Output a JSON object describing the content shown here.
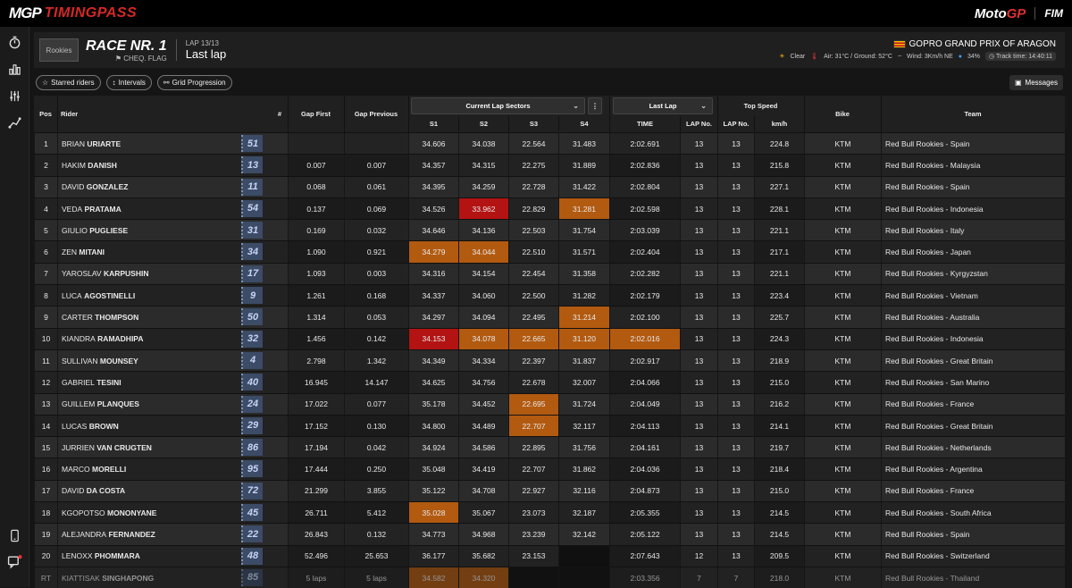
{
  "app": {
    "brand_mgp": "MGP",
    "brand_tp": "TIMINGPASS",
    "logo_moto": "Moto",
    "logo_gp": "GP",
    "logo_fim": "FIM"
  },
  "sidebar": [
    "stopwatch-icon",
    "bar-chart-icon",
    "gauge-icon",
    "track-icon",
    "phone-icon",
    "chat-alert-icon"
  ],
  "header": {
    "logo_text": "Rookies",
    "race_title": "RACE NR. 1",
    "race_status": "CHEQ. FLAG",
    "lap_label": "LAP 13/13",
    "lap_view": "Last lap",
    "gp_name": "GOPRO GRAND PRIX OF ARAGON",
    "weather": {
      "sky": "Clear",
      "temps": "Air: 31°C / Ground: 52°C",
      "wind": "Wind: 3Km/h NE",
      "humidity": "34%",
      "track_time": "Track time: 14:40:11"
    }
  },
  "controls": {
    "starred": "Starred riders",
    "intervals": "Intervals",
    "grid": "Grid Progression",
    "messages": "Messages"
  },
  "columns": {
    "pos": "Pos",
    "rider": "Rider",
    "num": "#",
    "gap_first": "Gap First",
    "gap_prev": "Gap Previous",
    "sectors_dropdown": "Current Lap Sectors",
    "s1": "S1",
    "s2": "S2",
    "s3": "S3",
    "s4": "S4",
    "lap_dropdown": "Last Lap",
    "time": "TIME",
    "lapno1": "LAP No.",
    "top_speed": "Top Speed",
    "lapno2": "LAP No.",
    "kmh": "km/h",
    "bike": "Bike",
    "team": "Team"
  },
  "rows": [
    {
      "pos": "1",
      "first": "BRIAN",
      "last": "URIARTE",
      "num": "51",
      "gf": "",
      "gp": "",
      "s1": "34.606",
      "s2": "34.038",
      "s3": "22.564",
      "s4": "31.483",
      "time": "2:02.691",
      "lap1": "13",
      "lap2": "13",
      "kmh": "224.8",
      "bike": "KTM",
      "team": "Red Bull Rookies - Spain",
      "hl": {}
    },
    {
      "pos": "2",
      "first": "HAKIM",
      "last": "DANISH",
      "num": "13",
      "gf": "0.007",
      "gp": "0.007",
      "s1": "34.357",
      "s2": "34.315",
      "s3": "22.275",
      "s4": "31.889",
      "time": "2:02.836",
      "lap1": "13",
      "lap2": "13",
      "kmh": "215.8",
      "bike": "KTM",
      "team": "Red Bull Rookies - Malaysia",
      "hl": {}
    },
    {
      "pos": "3",
      "first": "DAVID",
      "last": "GONZALEZ",
      "num": "11",
      "gf": "0.068",
      "gp": "0.061",
      "s1": "34.395",
      "s2": "34.259",
      "s3": "22.728",
      "s4": "31.422",
      "time": "2:02.804",
      "lap1": "13",
      "lap2": "13",
      "kmh": "227.1",
      "bike": "KTM",
      "team": "Red Bull Rookies - Spain",
      "hl": {}
    },
    {
      "pos": "4",
      "first": "VEDA",
      "last": "PRATAMA",
      "num": "54",
      "gf": "0.137",
      "gp": "0.069",
      "s1": "34.526",
      "s2": "33.962",
      "s3": "22.829",
      "s4": "31.281",
      "time": "2:02.598",
      "lap1": "13",
      "lap2": "13",
      "kmh": "228.1",
      "bike": "KTM",
      "team": "Red Bull Rookies - Indonesia",
      "hl": {
        "s2": "red",
        "s4": "orange"
      }
    },
    {
      "pos": "5",
      "first": "GIULIO",
      "last": "PUGLIESE",
      "num": "31",
      "gf": "0.169",
      "gp": "0.032",
      "s1": "34.646",
      "s2": "34.136",
      "s3": "22.503",
      "s4": "31.754",
      "time": "2:03.039",
      "lap1": "13",
      "lap2": "13",
      "kmh": "221.1",
      "bike": "KTM",
      "team": "Red Bull Rookies - Italy",
      "hl": {}
    },
    {
      "pos": "6",
      "first": "ZEN",
      "last": "MITANI",
      "num": "34",
      "gf": "1.090",
      "gp": "0.921",
      "s1": "34.279",
      "s2": "34.044",
      "s3": "22.510",
      "s4": "31.571",
      "time": "2:02.404",
      "lap1": "13",
      "lap2": "13",
      "kmh": "217.1",
      "bike": "KTM",
      "team": "Red Bull Rookies - Japan",
      "hl": {
        "s1": "orange",
        "s2": "orange"
      }
    },
    {
      "pos": "7",
      "first": "YAROSLAV",
      "last": "KARPUSHIN",
      "num": "17",
      "gf": "1.093",
      "gp": "0.003",
      "s1": "34.316",
      "s2": "34.154",
      "s3": "22.454",
      "s4": "31.358",
      "time": "2:02.282",
      "lap1": "13",
      "lap2": "13",
      "kmh": "221.1",
      "bike": "KTM",
      "team": "Red Bull Rookies - Kyrgyzstan",
      "hl": {}
    },
    {
      "pos": "8",
      "first": "LUCA",
      "last": "AGOSTINELLI",
      "num": "9",
      "gf": "1.261",
      "gp": "0.168",
      "s1": "34.337",
      "s2": "34.060",
      "s3": "22.500",
      "s4": "31.282",
      "time": "2:02.179",
      "lap1": "13",
      "lap2": "13",
      "kmh": "223.4",
      "bike": "KTM",
      "team": "Red Bull Rookies - Vietnam",
      "hl": {}
    },
    {
      "pos": "9",
      "first": "CARTER",
      "last": "THOMPSON",
      "num": "50",
      "gf": "1.314",
      "gp": "0.053",
      "s1": "34.297",
      "s2": "34.094",
      "s3": "22.495",
      "s4": "31.214",
      "time": "2:02.100",
      "lap1": "13",
      "lap2": "13",
      "kmh": "225.7",
      "bike": "KTM",
      "team": "Red Bull Rookies - Australia",
      "hl": {
        "s4": "orange"
      }
    },
    {
      "pos": "10",
      "first": "KIANDRA",
      "last": "RAMADHIPA",
      "num": "32",
      "gf": "1.456",
      "gp": "0.142",
      "s1": "34.153",
      "s2": "34.078",
      "s3": "22.665",
      "s4": "31.120",
      "time": "2:02.016",
      "lap1": "13",
      "lap2": "13",
      "kmh": "224.3",
      "bike": "KTM",
      "team": "Red Bull Rookies - Indonesia",
      "hl": {
        "s1": "red",
        "s2": "orange",
        "s3": "orange",
        "s4": "orange",
        "time": "orange"
      }
    },
    {
      "pos": "11",
      "first": "SULLIVAN",
      "last": "MOUNSEY",
      "num": "4",
      "gf": "2.798",
      "gp": "1.342",
      "s1": "34.349",
      "s2": "34.334",
      "s3": "22.397",
      "s4": "31.837",
      "time": "2:02.917",
      "lap1": "13",
      "lap2": "13",
      "kmh": "218.9",
      "bike": "KTM",
      "team": "Red Bull Rookies - Great Britain",
      "hl": {}
    },
    {
      "pos": "12",
      "first": "GABRIEL",
      "last": "TESINI",
      "num": "40",
      "gf": "16.945",
      "gp": "14.147",
      "s1": "34.625",
      "s2": "34.756",
      "s3": "22.678",
      "s4": "32.007",
      "time": "2:04.066",
      "lap1": "13",
      "lap2": "13",
      "kmh": "215.0",
      "bike": "KTM",
      "team": "Red Bull Rookies - San Marino",
      "hl": {}
    },
    {
      "pos": "13",
      "first": "GUILLEM",
      "last": "PLANQUES",
      "num": "24",
      "gf": "17.022",
      "gp": "0.077",
      "s1": "35.178",
      "s2": "34.452",
      "s3": "22.695",
      "s4": "31.724",
      "time": "2:04.049",
      "lap1": "13",
      "lap2": "13",
      "kmh": "216.2",
      "bike": "KTM",
      "team": "Red Bull Rookies - France",
      "hl": {
        "s3": "orange"
      }
    },
    {
      "pos": "14",
      "first": "LUCAS",
      "last": "BROWN",
      "num": "29",
      "gf": "17.152",
      "gp": "0.130",
      "s1": "34.800",
      "s2": "34.489",
      "s3": "22.707",
      "s4": "32.117",
      "time": "2:04.113",
      "lap1": "13",
      "lap2": "13",
      "kmh": "214.1",
      "bike": "KTM",
      "team": "Red Bull Rookies - Great Britain",
      "hl": {
        "s3": "orange"
      }
    },
    {
      "pos": "15",
      "first": "JURRIEN",
      "last": "VAN CRUGTEN",
      "num": "86",
      "gf": "17.194",
      "gp": "0.042",
      "s1": "34.924",
      "s2": "34.586",
      "s3": "22.895",
      "s4": "31.756",
      "time": "2:04.161",
      "lap1": "13",
      "lap2": "13",
      "kmh": "219.7",
      "bike": "KTM",
      "team": "Red Bull Rookies - Netherlands",
      "hl": {}
    },
    {
      "pos": "16",
      "first": "MARCO",
      "last": "MORELLI",
      "num": "95",
      "gf": "17.444",
      "gp": "0.250",
      "s1": "35.048",
      "s2": "34.419",
      "s3": "22.707",
      "s4": "31.862",
      "time": "2:04.036",
      "lap1": "13",
      "lap2": "13",
      "kmh": "218.4",
      "bike": "KTM",
      "team": "Red Bull Rookies - Argentina",
      "hl": {}
    },
    {
      "pos": "17",
      "first": "DAVID",
      "last": "DA COSTA",
      "num": "72",
      "gf": "21.299",
      "gp": "3.855",
      "s1": "35.122",
      "s2": "34.708",
      "s3": "22.927",
      "s4": "32.116",
      "time": "2:04.873",
      "lap1": "13",
      "lap2": "13",
      "kmh": "215.0",
      "bike": "KTM",
      "team": "Red Bull Rookies - France",
      "hl": {}
    },
    {
      "pos": "18",
      "first": "KGOPOTSO",
      "last": "MONONYANE",
      "num": "45",
      "gf": "26.711",
      "gp": "5.412",
      "s1": "35.028",
      "s2": "35.067",
      "s3": "23.073",
      "s4": "32.187",
      "time": "2:05.355",
      "lap1": "13",
      "lap2": "13",
      "kmh": "214.5",
      "bike": "KTM",
      "team": "Red Bull Rookies - South Africa",
      "hl": {
        "s1": "orange"
      }
    },
    {
      "pos": "19",
      "first": "ALEJANDRA",
      "last": "FERNANDEZ",
      "num": "22",
      "gf": "26.843",
      "gp": "0.132",
      "s1": "34.773",
      "s2": "34.968",
      "s3": "23.239",
      "s4": "32.142",
      "time": "2:05.122",
      "lap1": "13",
      "lap2": "13",
      "kmh": "214.5",
      "bike": "KTM",
      "team": "Red Bull Rookies - Spain",
      "hl": {}
    },
    {
      "pos": "20",
      "first": "LENOXX",
      "last": "PHOMMARA",
      "num": "48",
      "gf": "52.496",
      "gp": "25.653",
      "s1": "36.177",
      "s2": "35.682",
      "s3": "23.153",
      "s4": "",
      "time": "2:07.643",
      "lap1": "12",
      "lap2": "13",
      "kmh": "209.5",
      "bike": "KTM",
      "team": "Red Bull Rookies - Switzerland",
      "hl": {
        "s4": "black"
      }
    },
    {
      "pos": "RT",
      "first": "KIATTISAK",
      "last": "SINGHAPONG",
      "num": "85",
      "gf": "5 laps",
      "gp": "5 laps",
      "s1": "34.582",
      "s2": "34.320",
      "s3": "",
      "s4": "",
      "time": "2:03.356",
      "lap1": "7",
      "lap2": "7",
      "kmh": "218.0",
      "bike": "KTM",
      "team": "Red Bull Rookies - Thailand",
      "hl": {
        "s1": "orange",
        "s2": "orange",
        "s3": "black",
        "s4": "black"
      },
      "retired": true
    }
  ]
}
